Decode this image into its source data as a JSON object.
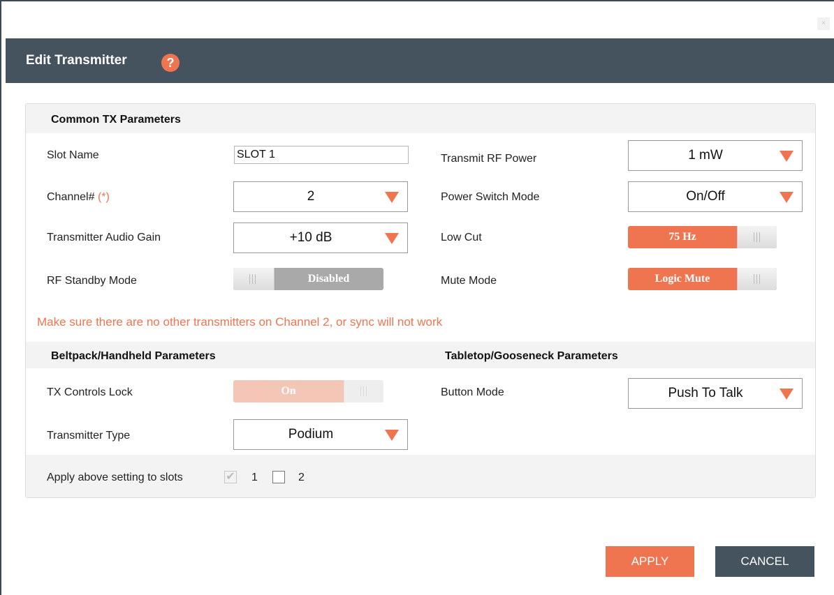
{
  "window": {
    "close_glyph": "×"
  },
  "dialog": {
    "title": "Edit Transmitter",
    "help_glyph": "?"
  },
  "common": {
    "section_title": "Common TX Parameters",
    "slot_name_label": "Slot Name",
    "slot_name_value": "SLOT 1",
    "channel_label": "Channel#",
    "channel_required": "(*)",
    "channel_value": "2",
    "audio_gain_label": "Transmitter Audio Gain",
    "audio_gain_value": "+10 dB",
    "rf_standby_label": "RF Standby Mode",
    "rf_standby_value": "Disabled",
    "rf_power_label": "Transmit RF Power",
    "rf_power_value": "1 mW",
    "power_switch_label": "Power Switch Mode",
    "power_switch_value": "On/Off",
    "low_cut_label": "Low Cut",
    "low_cut_value": "75 Hz",
    "mute_mode_label": "Mute Mode",
    "mute_mode_value": "Logic Mute",
    "warning": "Make sure there are no other transmitters on Channel 2, or sync will not work"
  },
  "beltpack": {
    "section_title": "Beltpack/Handheld Parameters",
    "controls_lock_label": "TX Controls Lock",
    "controls_lock_value": "On",
    "tx_type_label": "Transmitter Type",
    "tx_type_value": "Podium"
  },
  "tabletop": {
    "section_title": "Tabletop/Gooseneck Parameters",
    "button_mode_label": "Button Mode",
    "button_mode_value": "Push To Talk"
  },
  "apply_slots": {
    "label": "Apply above setting to slots",
    "slot1_label": "1",
    "slot1_checked": true,
    "slot2_label": "2",
    "slot2_checked": false,
    "check_glyph": "✔"
  },
  "buttons": {
    "apply": "APPLY",
    "cancel": "CANCEL"
  },
  "colors": {
    "accent": "#ef7551",
    "header": "#45535e",
    "cancel": "#45535e"
  }
}
